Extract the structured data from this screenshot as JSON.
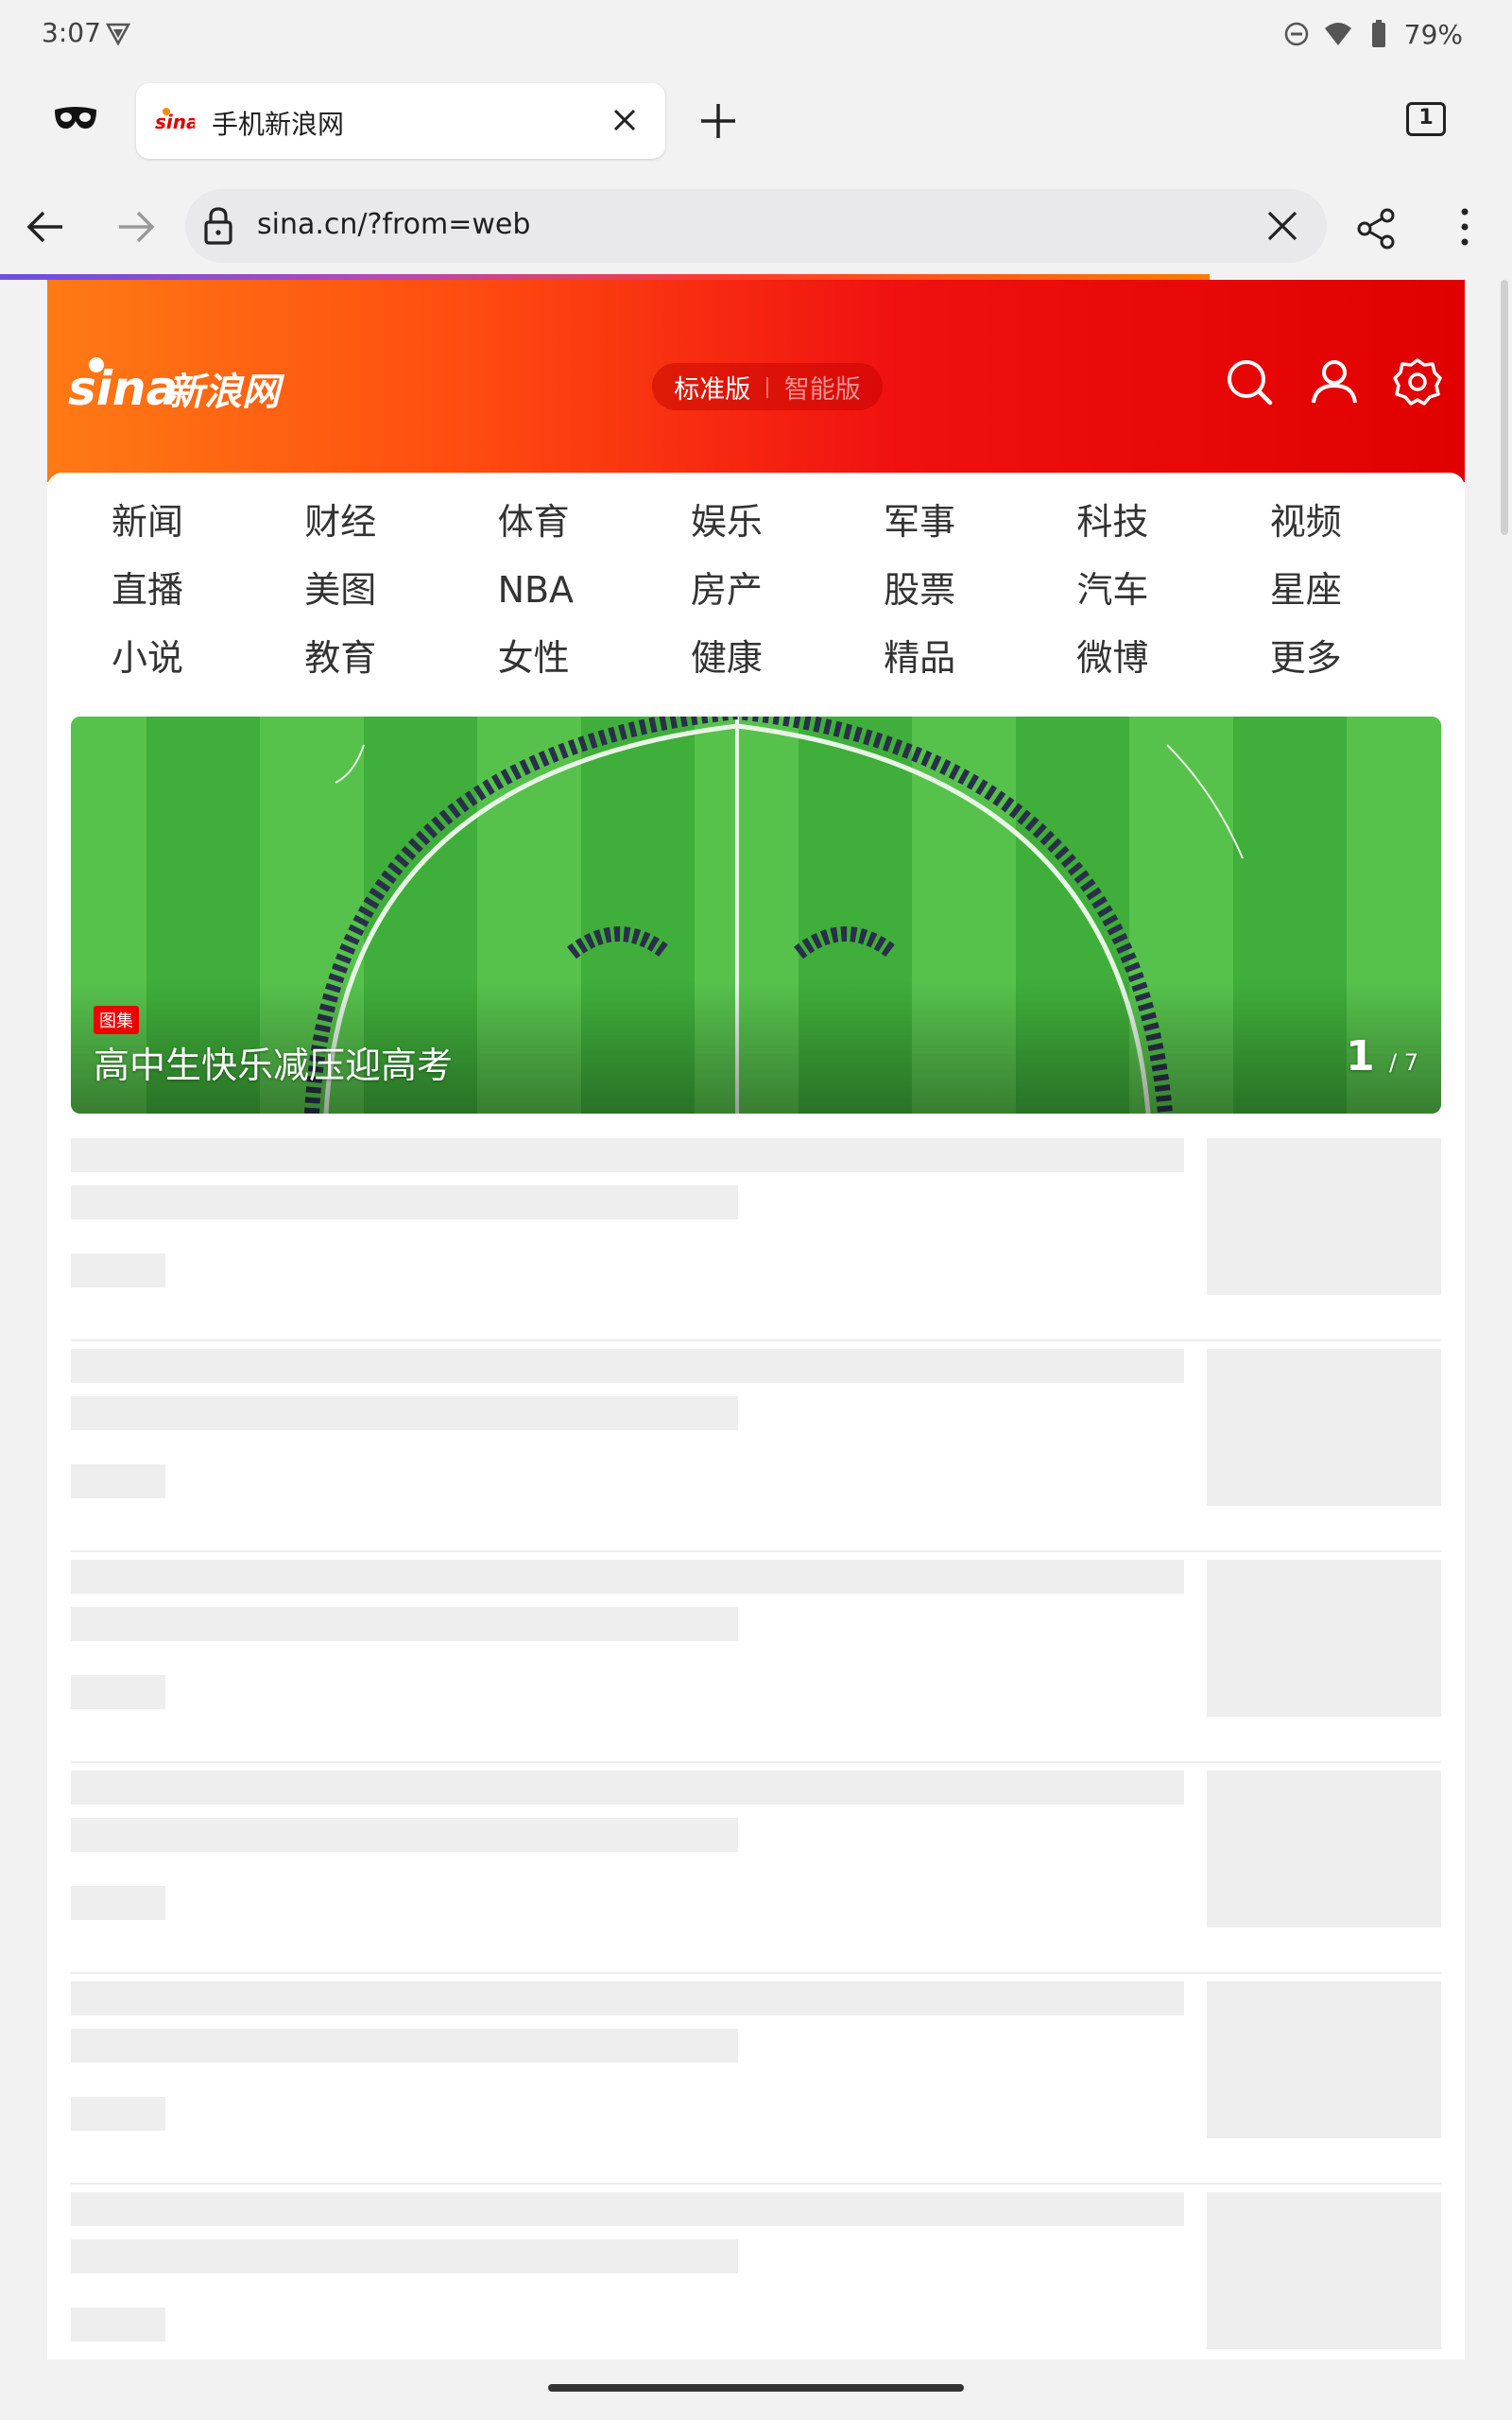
{
  "status_bar": {
    "time": "3:07",
    "battery": "79%"
  },
  "tab": {
    "title": "手机新浪网",
    "count": "1"
  },
  "url_bar": {
    "url": "sina.cn/?from=web"
  },
  "header": {
    "version_standard": "标准版",
    "version_smart": "智能版",
    "divider": "|"
  },
  "nav": {
    "items": [
      "新闻",
      "财经",
      "体育",
      "娱乐",
      "军事",
      "科技",
      "视频",
      "直播",
      "美图",
      "NBA",
      "房产",
      "股票",
      "汽车",
      "星座",
      "小说",
      "教育",
      "女性",
      "健康",
      "精品",
      "微博",
      "更多"
    ]
  },
  "banner": {
    "tag": "图集",
    "title": "高中生快乐减压迎高考",
    "index": "1",
    "total": "/ 7"
  },
  "colors": {
    "brand_red": "#e00000",
    "brand_orange": "#ff7a14"
  },
  "icons": [
    "vpn-key-icon",
    "dnd-icon",
    "wifi-icon",
    "battery-icon",
    "incognito-icon",
    "sina-favicon-icon",
    "close-icon",
    "plus-icon",
    "back-icon",
    "forward-icon",
    "lock-icon",
    "share-icon",
    "more-vert-icon",
    "search-icon",
    "user-icon",
    "settings-icon"
  ]
}
